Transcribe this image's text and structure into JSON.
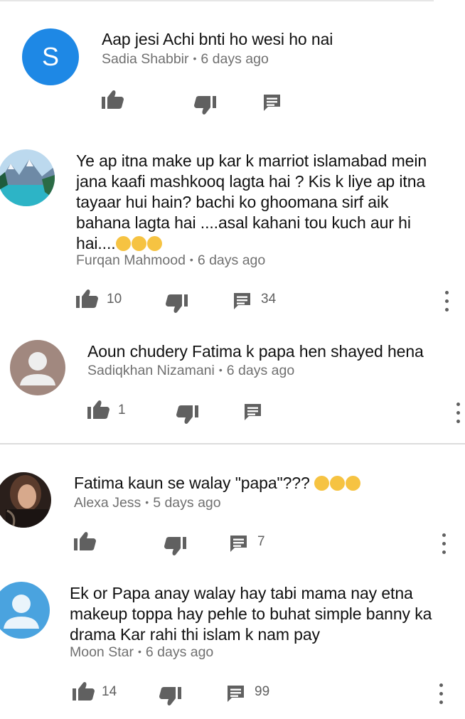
{
  "comments": [
    {
      "text": "Aap jesi Achi bnti ho wesi ho nai",
      "author": "Sadia Shabbir",
      "time": "6 days ago",
      "avatar_letter": "S",
      "avatar_color": "#1e88e5",
      "likes": "",
      "replies": ""
    },
    {
      "text": "Ye ap itna make up kar k marriot islamabad mein jana kaafi mashkooq lagta hai ? Kis k liye ap itna tayaar hui hain? bachi ko ghoomana sirf aik bahana lagta hai ....asal kahani tou kuch aur hi hai....",
      "emojis": [
        "thinking-face-emoji",
        "unamused-face-emoji",
        "unamused-face-emoji"
      ],
      "author": "Furqan Mahmood",
      "time": "6 days ago",
      "avatar_image": "mountain-lake-landscape",
      "likes": "10",
      "replies": "34"
    },
    {
      "text": "Aoun chudery Fatima k papa hen shayed hena",
      "author": "Sadiqkhan Nizamani",
      "time": "6 days ago",
      "avatar_image": "default-profile-silhouette",
      "avatar_color": "#a1887f",
      "likes": "1",
      "replies": ""
    },
    {
      "text": "Fatima kaun se walay \"papa\"???",
      "emojis": [
        "laughing-face-emoji",
        "laughing-face-emoji",
        "laughing-face-emoji"
      ],
      "author": "Alexa Jess",
      "time": "5 days ago",
      "avatar_image": "woman-portrait-photo",
      "likes": "",
      "replies": "7"
    },
    {
      "text": "Ek or Papa anay walay hay tabi mama nay etna makeup toppa hay pehle to buhat simple banny ka drama Kar rahi thi islam k nam pay",
      "author": "Moon Star",
      "time": "6 days ago",
      "avatar_image": "default-profile-silhouette",
      "avatar_color": "#4aa3df",
      "likes": "14",
      "replies": "99"
    }
  ],
  "icons": {
    "like": "thumbs-up-icon",
    "dislike": "thumbs-down-icon",
    "reply": "reply-comment-icon",
    "more": "more-vert-icon"
  },
  "colors": {
    "icon": "#606060",
    "meta": "#707070"
  }
}
